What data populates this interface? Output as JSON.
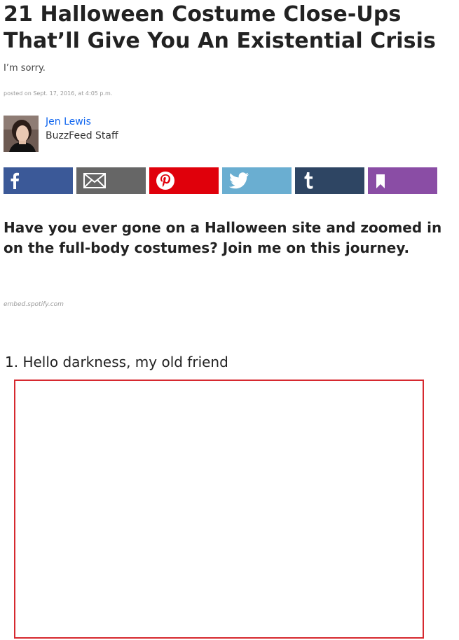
{
  "article": {
    "title": "21 Halloween Costume Close-Ups That’ll Give You An Existential Crisis",
    "subtitle": "I’m sorry.",
    "posted": "posted on Sept. 17, 2016, at 4:05 p.m."
  },
  "author": {
    "name": "Jen Lewis",
    "role": "BuzzFeed Staff"
  },
  "share": {
    "buttons": [
      {
        "name": "facebook",
        "icon": "facebook-icon",
        "color": "#3b5998"
      },
      {
        "name": "email",
        "icon": "mail-icon",
        "color": "#666666"
      },
      {
        "name": "pinterest",
        "icon": "pinterest-icon",
        "color": "#e0000b"
      },
      {
        "name": "twitter",
        "icon": "twitter-icon",
        "color": "#6aaed1"
      },
      {
        "name": "tumblr",
        "icon": "tumblr-icon",
        "color": "#2e4563"
      },
      {
        "name": "bookmark",
        "icon": "bookmark-icon",
        "color": "#8a4da5"
      }
    ]
  },
  "body": {
    "intro": "Have you ever gone on a Halloween site and zoomed in on the full-body costumes? Join me on this journey.",
    "embed_credit": "embed.spotify.com",
    "item1_heading": "1. Hello darkness, my old friend"
  },
  "colors": {
    "author_link": "#0f65ef",
    "image_border": "#d6292f"
  }
}
